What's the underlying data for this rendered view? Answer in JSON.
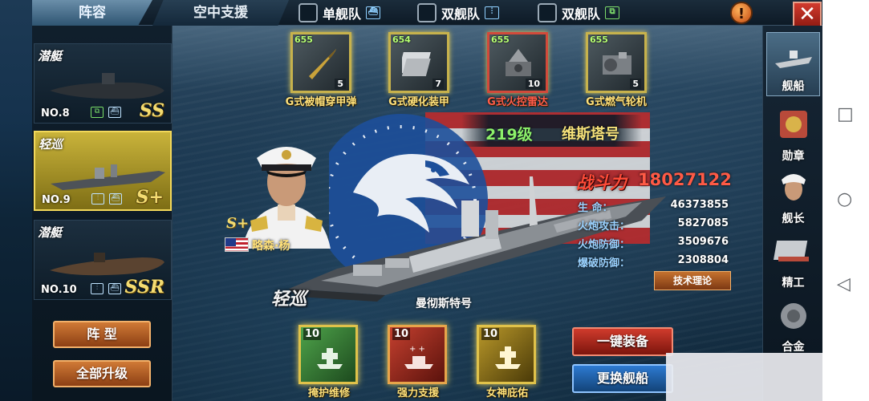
{
  "tabs": {
    "lineup": "阵容",
    "air_support": "空中支援"
  },
  "fleet_options": [
    {
      "label": "单舰队",
      "icon": "single-fleet-icon",
      "icon_char": "⛴"
    },
    {
      "label": "双舰队",
      "icon": "double-fleet-icon",
      "icon_char": "⫶"
    },
    {
      "label": "双舰队",
      "icon": "double-fleet-green-icon",
      "icon_char": "⧉"
    }
  ],
  "top_icons": {
    "warning": "!",
    "close": "✕"
  },
  "ship_list": [
    {
      "type": "潜艇",
      "no": "NO.8",
      "rank": "SS",
      "selected": false
    },
    {
      "type": "轻巡",
      "no": "NO.9",
      "rank": "S+",
      "selected": true
    },
    {
      "type": "潜艇",
      "no": "NO.10",
      "rank": "SSR",
      "selected": false
    }
  ],
  "left_buttons": {
    "formation": "阵 型",
    "upgrade_all": "全部升级"
  },
  "equipment": [
    {
      "level": "655",
      "count": "5",
      "name": "G式被帽穿甲弹",
      "art": "shell"
    },
    {
      "level": "654",
      "count": "7",
      "name": "G式硬化装甲",
      "art": "armor"
    },
    {
      "level": "655",
      "count": "10",
      "name": "G式火控雷达",
      "art": "radar"
    },
    {
      "level": "655",
      "count": "5",
      "name": "G式燃气轮机",
      "art": "turbine"
    }
  ],
  "captain": {
    "rank": "S+",
    "name": "略森·杨"
  },
  "ship_info": {
    "class": "219级",
    "name": "维斯塔号",
    "power_label": "战斗力",
    "power": "18027122",
    "stats": [
      {
        "label": "生 命：",
        "value": "46373855"
      },
      {
        "label": "火炮攻击：",
        "value": "5827085"
      },
      {
        "label": "火炮防御：",
        "value": "3509676"
      },
      {
        "label": "爆破防御：",
        "value": "2308804"
      }
    ],
    "tech_button": "技术理论"
  },
  "ship_badge": "轻巡",
  "ship_caption": "曼彻斯特号",
  "skills": [
    {
      "level": "10",
      "name": "掩护维修",
      "color": "g"
    },
    {
      "level": "10",
      "name": "强力支援",
      "color": "r"
    },
    {
      "level": "10",
      "name": "女神庇佑",
      "color": "y"
    }
  ],
  "action_buttons": {
    "equip_all": "一键装备",
    "change_ship": "更换舰船"
  },
  "right_nav": [
    {
      "label": "舰船",
      "icon": "ship-icon",
      "active": true
    },
    {
      "label": "勋章",
      "icon": "medal-icon",
      "active": false
    },
    {
      "label": "舰长",
      "icon": "captain-icon",
      "active": false
    },
    {
      "label": "精工",
      "icon": "refine-icon",
      "active": false
    },
    {
      "label": "合金",
      "icon": "alloy-icon",
      "active": false
    }
  ],
  "android_nav": {
    "recent": "□",
    "home": "○",
    "back": "◁"
  },
  "colors": {
    "accent_gold": "#f4dc71",
    "power_red": "#ff4b38",
    "class_green": "#8cf06a"
  }
}
